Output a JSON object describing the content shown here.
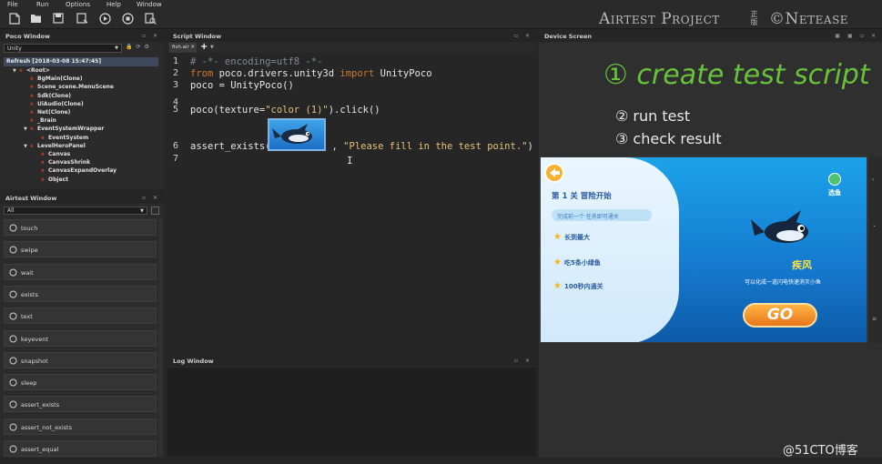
{
  "menu": [
    "File",
    "Run",
    "Options",
    "Help",
    "Window"
  ],
  "toolbar_icons": [
    "new-file-icon",
    "open-folder-icon",
    "save-icon",
    "save-as-icon",
    "run-icon",
    "stop-icon",
    "report-icon"
  ],
  "brand": {
    "name": "Airtest Project",
    "cn_mark": "正版",
    "company": "©Netease"
  },
  "poco_window": {
    "title": "Poco Window",
    "mode": "Unity",
    "refresh": "Refresh [2018-03-08 15:47:45]",
    "tree": [
      {
        "label": "<Root>",
        "depth": 0,
        "expanded": true
      },
      {
        "label": "BgMain(Clone)",
        "depth": 1,
        "expanded": false
      },
      {
        "label": "Scene_scene.MenuScene",
        "depth": 1,
        "expanded": false
      },
      {
        "label": "Sdk(Clone)",
        "depth": 1,
        "expanded": false
      },
      {
        "label": "UiAudio(Clone)",
        "depth": 1,
        "expanded": false
      },
      {
        "label": "Net(Clone)",
        "depth": 1,
        "expanded": false
      },
      {
        "label": "_Brain",
        "depth": 1,
        "expanded": false
      },
      {
        "label": "EventSystemWrapper",
        "depth": 1,
        "expanded": true
      },
      {
        "label": "EventSystem",
        "depth": 2,
        "expanded": false
      },
      {
        "label": "LevelHeroPanel",
        "depth": 1,
        "expanded": true
      },
      {
        "label": "Canvas",
        "depth": 2,
        "expanded": false
      },
      {
        "label": "CanvasShrink",
        "depth": 2,
        "expanded": false
      },
      {
        "label": "CanvasExpandOverlay",
        "depth": 2,
        "expanded": false
      },
      {
        "label": "Object",
        "depth": 2,
        "expanded": false
      }
    ]
  },
  "airtest_window": {
    "title": "Airtest Window",
    "filter": "All",
    "buttons": [
      "touch",
      "swipe",
      "wait",
      "exists",
      "text",
      "keyevent",
      "snapshot",
      "sleep",
      "assert_exists",
      "assert_not_exists",
      "assert_equal"
    ]
  },
  "script_window": {
    "title": "Script Window",
    "file_tab": "fish.air",
    "lines": [
      {
        "no": "1",
        "tokens": [
          {
            "t": "# -*- encoding=utf8 -*-",
            "c": "comment"
          }
        ]
      },
      {
        "no": "2",
        "tokens": [
          {
            "t": "from",
            "c": "kw"
          },
          {
            "t": " poco.drivers.unity3d ",
            "c": "plain"
          },
          {
            "t": "import",
            "c": "kw"
          },
          {
            "t": " UnityPoco",
            "c": "plain"
          }
        ]
      },
      {
        "no": "3",
        "tokens": [
          {
            "t": "poco = UnityPoco()",
            "c": "plain"
          }
        ]
      },
      {
        "no": "4",
        "tokens": []
      },
      {
        "no": "5",
        "tokens": [
          {
            "t": "poco(texture=",
            "c": "plain"
          },
          {
            "t": "\"color (1)\"",
            "c": "str"
          },
          {
            "t": ").click()",
            "c": "plain"
          }
        ]
      },
      {
        "no": "6",
        "tokens": [
          {
            "t": "assert_exists(",
            "c": "plain"
          },
          {
            "t": "IMAGE",
            "c": "img"
          },
          {
            "t": ", ",
            "c": "plain"
          },
          {
            "t": "\"Please fill in the test point.\"",
            "c": "str"
          },
          {
            "t": ")",
            "c": "plain"
          }
        ]
      },
      {
        "no": "7",
        "tokens": []
      }
    ]
  },
  "log_window": {
    "title": "Log Window"
  },
  "device_screen": {
    "title": "Device Screen",
    "overlay": {
      "step1": "① create test script",
      "step2": "② run test",
      "step3": "③ check result"
    },
    "game": {
      "level_title": "第 1 关 冒险开始",
      "hint": "完成前一个 任务即可通关",
      "tasks": [
        "长到最大",
        "吃5条小绿鱼",
        "100秒内通关"
      ],
      "select": "选鱼",
      "fish_name": "疾风",
      "fish_desc": "可以化成一道闪电快速消灭小鱼",
      "go": "GO"
    }
  },
  "watermark": "@51CTO博客"
}
